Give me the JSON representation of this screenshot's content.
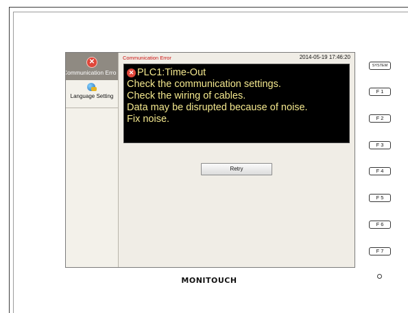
{
  "sidebar": {
    "items": [
      {
        "label": "Communication Erro",
        "icon": "error-icon"
      },
      {
        "label": "Language Setting",
        "icon": "globe-icon"
      }
    ]
  },
  "header": {
    "title": "Communication Error",
    "timestamp": "2014-05-19  17:46:20"
  },
  "message": {
    "error_symbol": "✕",
    "lines": [
      "PLC1:Time-Out",
      "Check the communication settings.",
      "Check the wiring of cables.",
      "Data may be disrupted because of noise.",
      "Fix noise."
    ]
  },
  "buttons": {
    "retry": "Retry"
  },
  "function_keys": [
    "SYSTEM",
    "F 1",
    "F 2",
    "F 3",
    "F 4",
    "F 5",
    "F 6",
    "F 7"
  ],
  "brand": "MONITOUCH",
  "colors": {
    "message_text": "#f4e88e",
    "message_bg": "#000000",
    "title_text": "#cc1111",
    "error_icon": "#e0463a"
  }
}
